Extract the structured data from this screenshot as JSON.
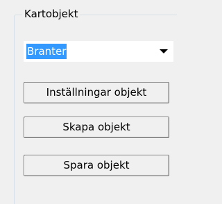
{
  "groupbox": {
    "title": "Kartobjekt"
  },
  "combo": {
    "selected": "Branter",
    "arrow_icon": "chevron-down-icon",
    "highlight_color": "#3399ff"
  },
  "buttons": {
    "installningar": "Inställningar objekt",
    "skapa": "Skapa objekt",
    "spara": "Spara objekt"
  }
}
